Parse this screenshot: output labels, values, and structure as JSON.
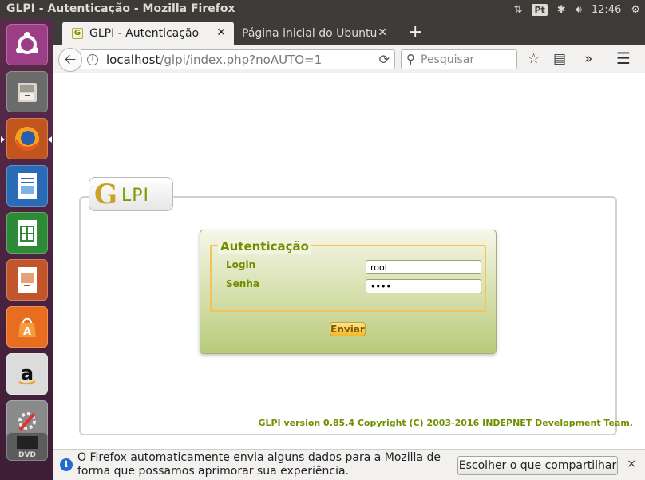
{
  "window": {
    "title": "GLPI - Autenticação - Mozilla Firefox"
  },
  "tray": {
    "keyboard": "Pt",
    "clock": "12:46"
  },
  "launcher": {
    "items": [
      {
        "name": "ubuntu-dash-icon"
      },
      {
        "name": "files-icon"
      },
      {
        "name": "firefox-icon",
        "active": true
      },
      {
        "name": "libreoffice-writer-icon"
      },
      {
        "name": "libreoffice-calc-icon"
      },
      {
        "name": "libreoffice-impress-icon"
      },
      {
        "name": "software-center-icon"
      },
      {
        "name": "amazon-icon"
      },
      {
        "name": "system-settings-icon"
      },
      {
        "name": "dvd-icon"
      }
    ]
  },
  "tabs": [
    {
      "label": "GLPI - Autenticação",
      "active": true
    },
    {
      "label": "Página inicial do Ubuntu",
      "active": false
    }
  ],
  "navbar": {
    "url_host": "localhost",
    "url_path": "/glpi/index.php?noAUTO=1",
    "search_placeholder": "Pesquisar"
  },
  "glpi": {
    "logo_g": "G",
    "logo_text": "LPI",
    "legend": "Autenticação",
    "login_label": "Login",
    "login_value": "root",
    "password_label": "Senha",
    "password_value": "••••",
    "submit_label": "Enviar",
    "version": "GLPI version 0.85.4 Copyright (C) 2003-2016 INDEPNET Development Team."
  },
  "notification": {
    "text": "O Firefox automaticamente envia alguns dados para a Mozilla de forma que possamos aprimorar sua experiência.",
    "button": "Escolher o que compartilhar",
    "close": "×"
  },
  "colors": {
    "glpi_green": "#6f8f00",
    "panel_dark": "#3c3b37",
    "launcher": "#4a2340"
  }
}
